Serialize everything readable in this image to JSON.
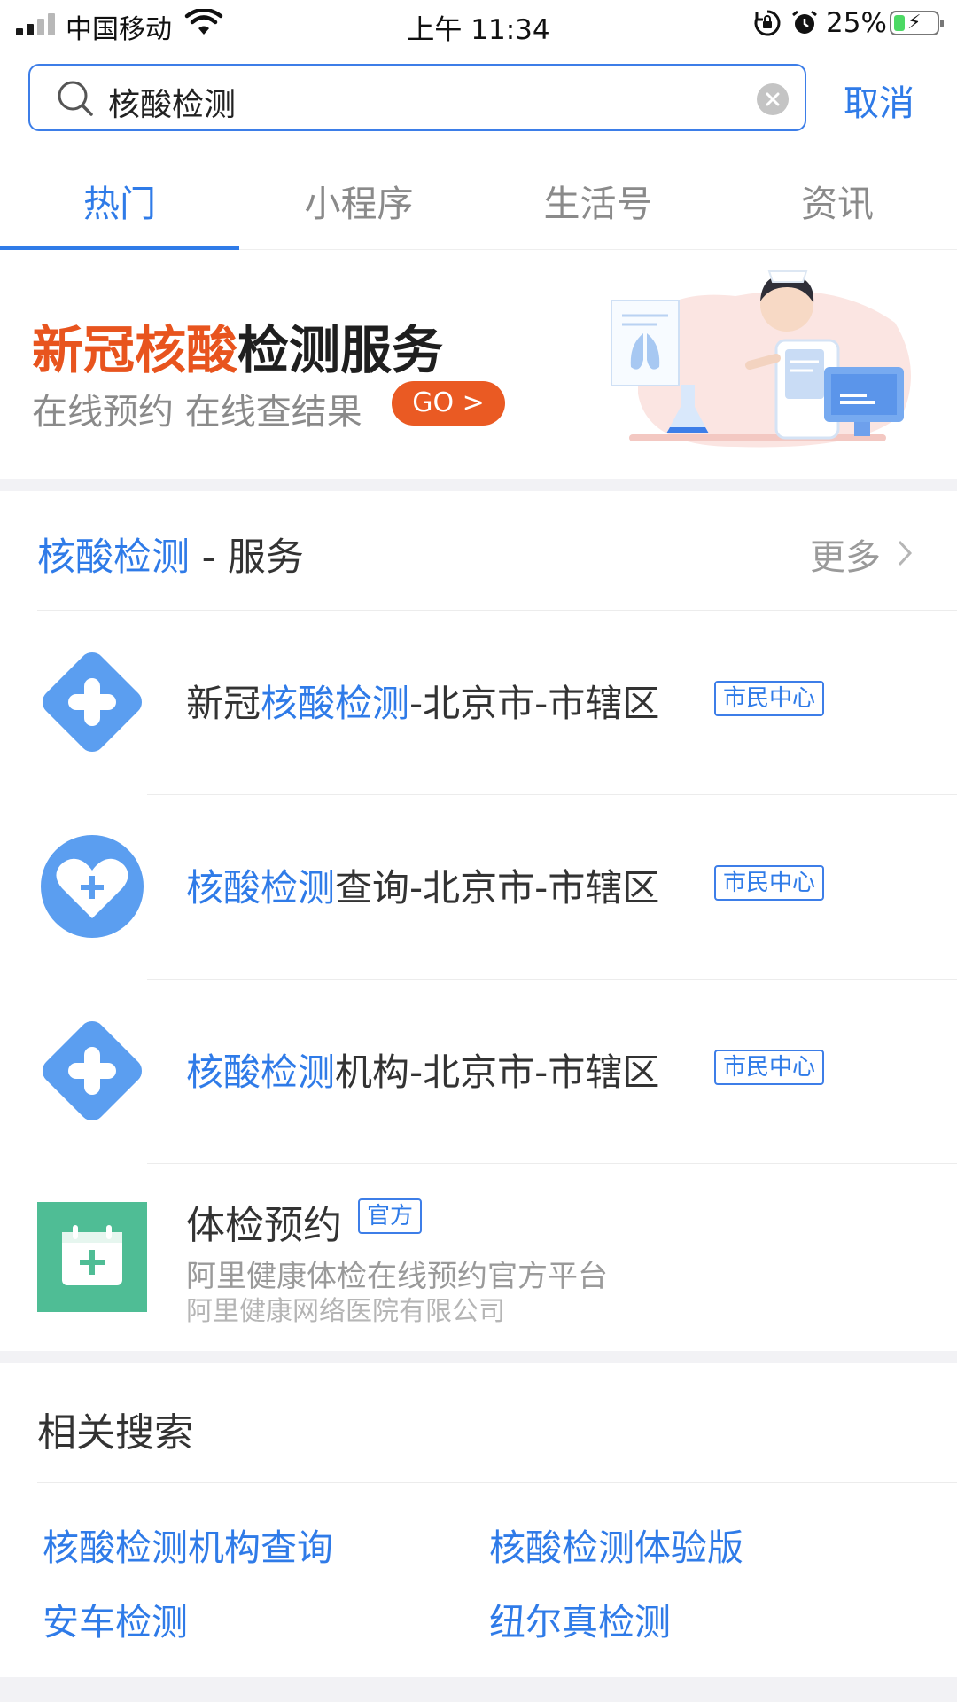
{
  "status_bar": {
    "carrier": "中国移动",
    "time": "上午 11:34",
    "battery_percent": "25%",
    "battery_level": 0.25,
    "icons": [
      "signal-icon",
      "wifi-icon",
      "orientation-lock-icon",
      "alarm-icon",
      "battery-charging-icon"
    ]
  },
  "search": {
    "query": "核酸检测",
    "cancel_label": "取消",
    "icons": [
      "search-icon",
      "clear-icon"
    ]
  },
  "tabs": [
    {
      "label": "热门",
      "active": true
    },
    {
      "label": "小程序",
      "active": false
    },
    {
      "label": "生活号",
      "active": false
    },
    {
      "label": "资讯",
      "active": false
    }
  ],
  "banner": {
    "title_highlight": "新冠核酸",
    "title_rest": "检测服务",
    "subtitle": "在线预约 在线查结果",
    "go_label": "GO >",
    "illustration": "nurse-illustration"
  },
  "service_section": {
    "keyword": "核酸检测",
    "suffix": " - 服务",
    "more_label": "更多"
  },
  "services": [
    {
      "prefix": "新冠",
      "keyword": "核酸检测",
      "suffix": "-北京市-市辖区",
      "tag": "市民中心",
      "icon": "medical-cross-icon"
    },
    {
      "prefix": "",
      "keyword": "核酸检测",
      "suffix": "查询-北京市-市辖区",
      "tag": "市民中心",
      "icon": "heart-plus-icon"
    },
    {
      "prefix": "",
      "keyword": "核酸检测",
      "suffix": "机构-北京市-市辖区",
      "tag": "市民中心",
      "icon": "medical-cross-icon"
    }
  ],
  "mini_app": {
    "title": "体检预约",
    "tag": "官方",
    "description": "阿里健康体检在线预约官方平台",
    "org": "阿里健康网络医院有限公司",
    "icon": "calendar-plus-icon"
  },
  "related": {
    "heading": "相关搜索",
    "items": [
      "核酸检测机构查询",
      "核酸检测体验版",
      "安车检测",
      "纽尔真检测"
    ]
  },
  "colors": {
    "accent": "#2f7be8",
    "banner_orange": "#e8541e",
    "service_icon_blue": "#5b9ef0",
    "tijian_green": "#4fbd95"
  }
}
